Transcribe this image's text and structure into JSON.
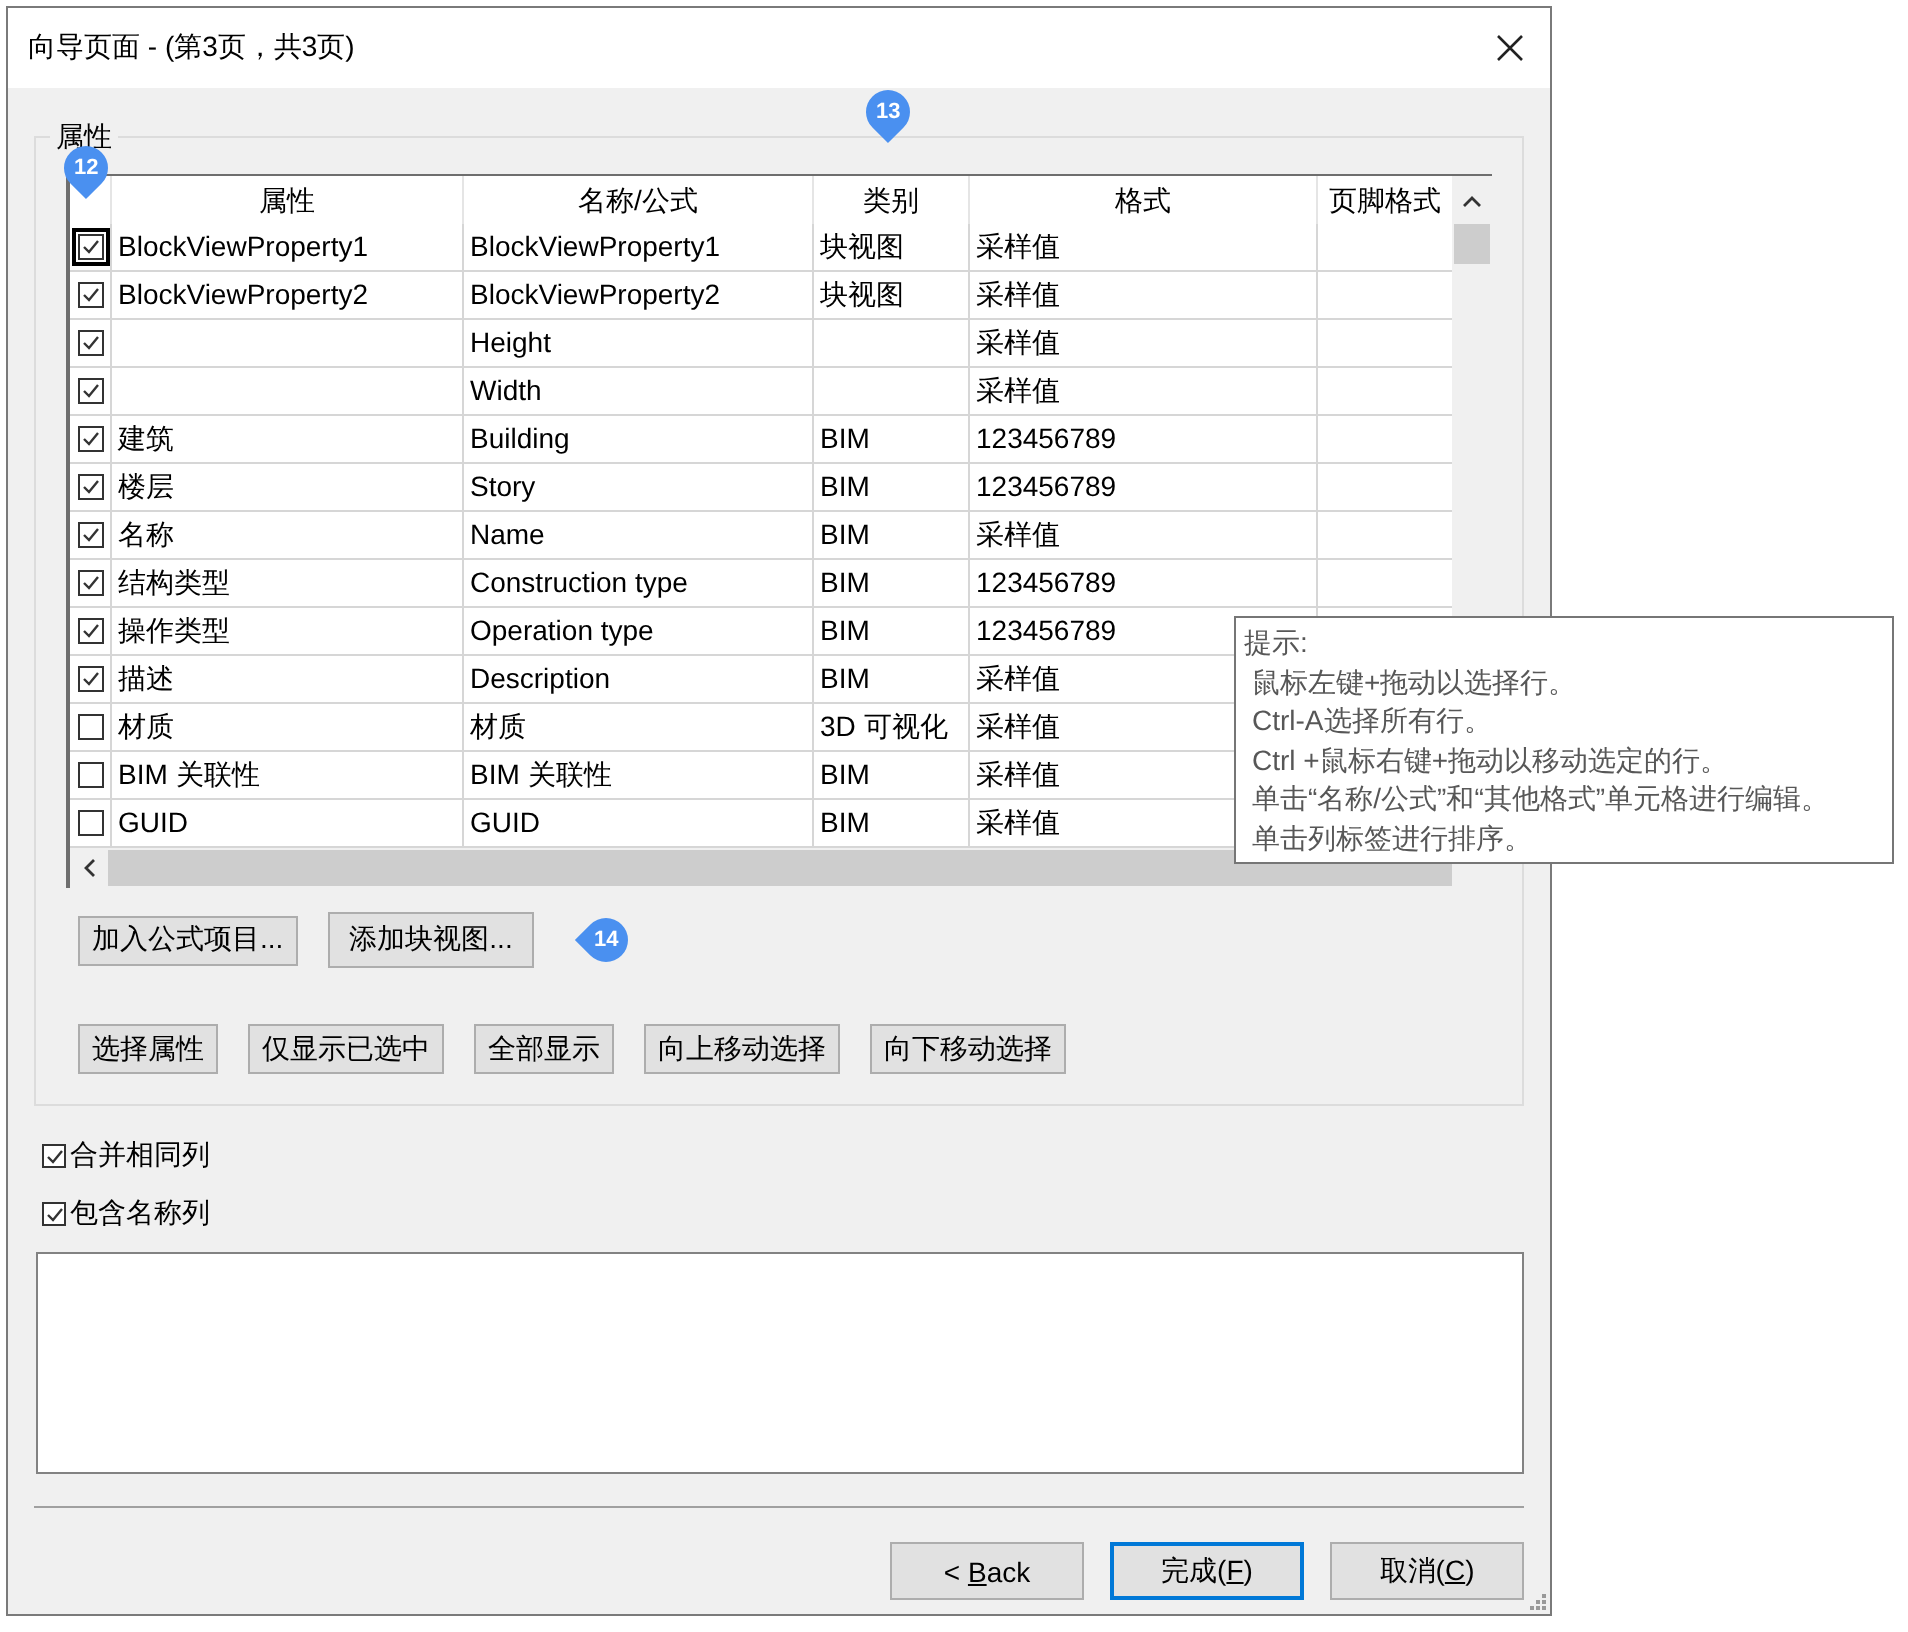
{
  "window": {
    "title": "向导页面 - (第3页，共3页)"
  },
  "group": {
    "title": "属性"
  },
  "table": {
    "columns": [
      "属性",
      "名称/公式",
      "类别",
      "格式",
      "页脚格式"
    ],
    "rows": [
      {
        "checked": true,
        "focused": true,
        "property": "BlockViewProperty1",
        "name": "BlockViewProperty1",
        "category": "块视图",
        "format": "采样值"
      },
      {
        "checked": true,
        "focused": false,
        "property": "BlockViewProperty2",
        "name": "BlockViewProperty2",
        "category": "块视图",
        "format": "采样值"
      },
      {
        "checked": true,
        "focused": false,
        "name": "Height",
        "format": "采样值"
      },
      {
        "checked": true,
        "focused": false,
        "name": "Width",
        "format": "采样值"
      },
      {
        "checked": true,
        "focused": false,
        "property": "建筑",
        "name": "Building",
        "category": "BIM",
        "format": "123456789"
      },
      {
        "checked": true,
        "focused": false,
        "property": "楼层",
        "name": "Story",
        "category": "BIM",
        "format": "123456789"
      },
      {
        "checked": true,
        "focused": false,
        "property": "名称",
        "name": "Name",
        "category": "BIM",
        "format": "采样值"
      },
      {
        "checked": true,
        "focused": false,
        "property": "结构类型",
        "name": "Construction type",
        "category": "BIM",
        "format": "123456789"
      },
      {
        "checked": true,
        "focused": false,
        "property": "操作类型",
        "name": "Operation type",
        "category": "BIM",
        "format": "123456789"
      },
      {
        "checked": true,
        "focused": false,
        "property": "描述",
        "name": "Description",
        "category": "BIM",
        "format": "采样值"
      },
      {
        "checked": false,
        "focused": false,
        "property": "材质",
        "name": "材质",
        "category": "3D 可视化",
        "format": "采样值"
      },
      {
        "checked": false,
        "focused": false,
        "property": "BIM 关联性",
        "name": "BIM 关联性",
        "category": "BIM",
        "format": "采样值"
      },
      {
        "checked": false,
        "focused": false,
        "property": "GUID",
        "name": "GUID",
        "category": "BIM",
        "format": "采样值"
      }
    ]
  },
  "buttons_row1": [
    "加入公式项目...",
    "添加块视图..."
  ],
  "buttons_row2": [
    "选择属性",
    "仅显示已选中",
    "全部显示",
    "向上移动选择",
    "向下移动选择"
  ],
  "options": [
    {
      "label": "合并相同列",
      "checked": true
    },
    {
      "label": "包含名称列",
      "checked": true
    }
  ],
  "footer_buttons": [
    {
      "before": "< ",
      "key": "B",
      "after": "ack",
      "default": false
    },
    {
      "before": "完成(",
      "key": "F",
      "after": ")",
      "default": true
    },
    {
      "before": "取消(",
      "key": "C",
      "after": ")",
      "default": false
    }
  ],
  "tooltip": {
    "title": "提示:",
    "lines": [
      "鼠标左键+拖动以选择行。",
      "Ctrl-A选择所有行。",
      "Ctrl +鼠标右键+拖动以移动选定的行。",
      "单击“名称/公式”和“其他格式”单元格进行编辑。",
      "单击列标签进行排序。"
    ]
  },
  "callouts": [
    {
      "number": "12",
      "kind": "down"
    },
    {
      "number": "13",
      "kind": "down"
    },
    {
      "number": "14",
      "kind": "left"
    }
  ]
}
